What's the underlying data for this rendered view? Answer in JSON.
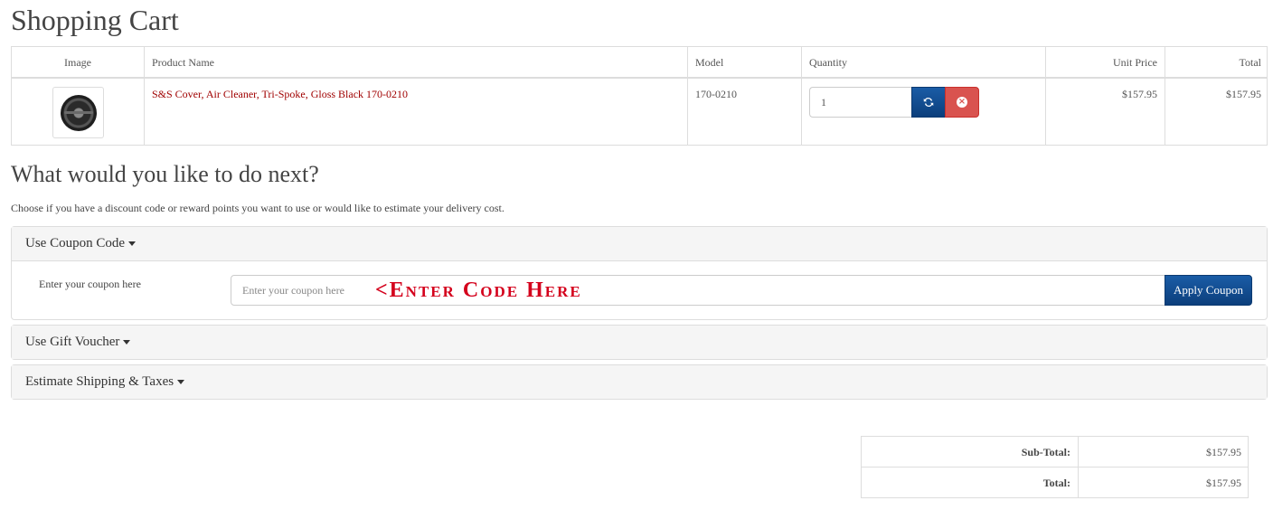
{
  "page": {
    "title": "Shopping Cart"
  },
  "cart": {
    "headers": {
      "image": "Image",
      "name": "Product Name",
      "model": "Model",
      "quantity": "Quantity",
      "unit_price": "Unit Price",
      "total": "Total"
    },
    "items": [
      {
        "name": "S&S Cover, Air Cleaner, Tri-Spoke, Gloss Black 170-0210",
        "model": "170-0210",
        "quantity": "1",
        "unit_price": "$157.95",
        "total": "$157.95",
        "image_icon": "air-cleaner-cover-icon"
      }
    ],
    "icons": {
      "update": "refresh-icon",
      "remove": "remove-circle-icon"
    }
  },
  "next": {
    "heading": "What would you like to do next?",
    "description": "Choose if you have a discount code or reward points you want to use or would like to estimate your delivery cost."
  },
  "coupon": {
    "title": "Use Coupon Code",
    "label": "Enter your coupon here",
    "placeholder": "Enter your coupon here",
    "annotation": "<Enter Code Here",
    "apply_label": "Apply Coupon"
  },
  "voucher": {
    "title": "Use Gift Voucher"
  },
  "shipping": {
    "title": "Estimate Shipping & Taxes"
  },
  "totals": [
    {
      "label": "Sub-Total:",
      "value": "$157.95"
    },
    {
      "label": "Total:",
      "value": "$157.95"
    }
  ],
  "colors": {
    "primary": "#0c3f7c",
    "danger": "#d9534f",
    "link": "#a00000",
    "annotation": "#d4001c"
  }
}
